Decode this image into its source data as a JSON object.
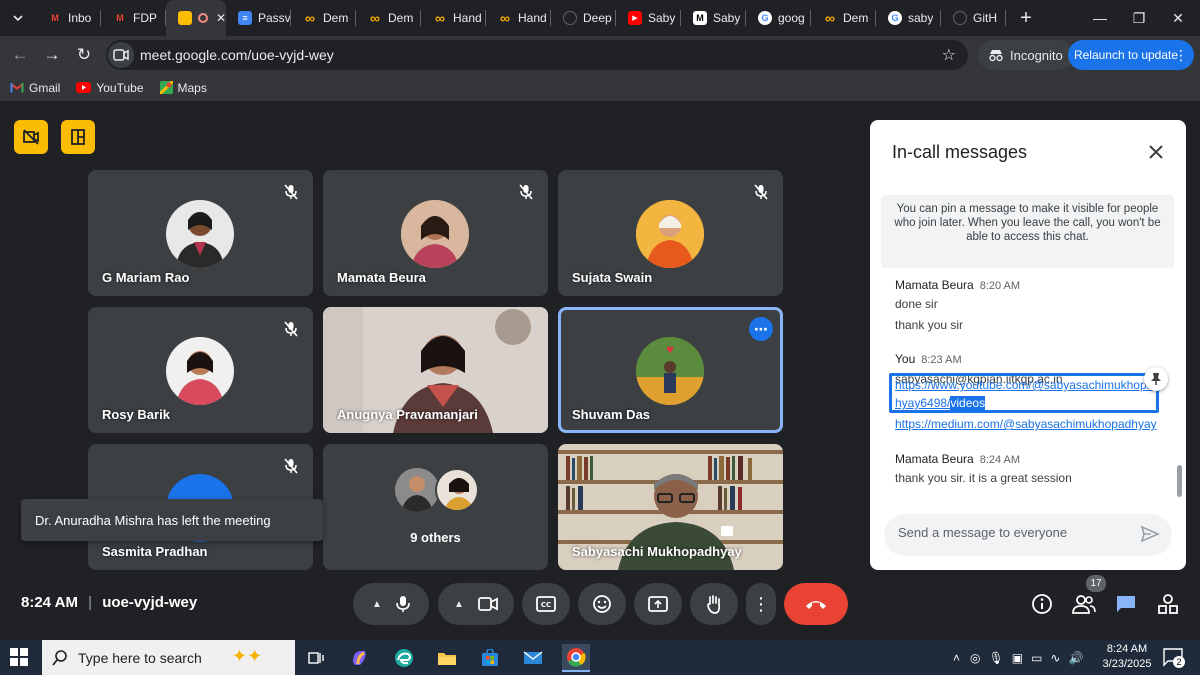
{
  "browser": {
    "tabs": [
      {
        "label": "Inbo",
        "favicon": "gmail-icon",
        "color": "#ea4335"
      },
      {
        "label": "FDP",
        "favicon": "gmail-icon",
        "color": "#ea4335"
      },
      {
        "label": "",
        "favicon": "meet-icon",
        "color": "#34a853",
        "active": true
      },
      {
        "label": "Passv",
        "favicon": "docs-icon",
        "color": "#4285f4"
      },
      {
        "label": "Dem",
        "favicon": "colab-icon",
        "color": "#f9ab00"
      },
      {
        "label": "Dem",
        "favicon": "colab-icon",
        "color": "#f9ab00"
      },
      {
        "label": "Hand",
        "favicon": "colab-icon",
        "color": "#f9ab00"
      },
      {
        "label": "Hand",
        "favicon": "colab-icon",
        "color": "#f9ab00"
      },
      {
        "label": "Deep",
        "favicon": "loading-icon",
        "color": "#5f6368"
      },
      {
        "label": "Saby",
        "favicon": "youtube-icon",
        "color": "#ff0000"
      },
      {
        "label": "Saby",
        "favicon": "medium-icon",
        "color": "#000000"
      },
      {
        "label": "goog",
        "favicon": "google-icon",
        "color": "#ffffff"
      },
      {
        "label": "Dem",
        "favicon": "colab-icon",
        "color": "#f9ab00"
      },
      {
        "label": "saby",
        "favicon": "google-icon",
        "color": "#ffffff"
      },
      {
        "label": "GitH",
        "favicon": "github-icon",
        "color": "#5f6368"
      }
    ],
    "url": "meet.google.com/uoe-vyjd-wey",
    "incognito_label": "Incognito",
    "relaunch_label": "Relaunch to update",
    "bookmarks": [
      {
        "label": "Gmail",
        "icon": "gmail-icon"
      },
      {
        "label": "YouTube",
        "icon": "youtube-icon"
      },
      {
        "label": "Maps",
        "icon": "maps-icon"
      }
    ]
  },
  "meet": {
    "participants": [
      {
        "name": "G Mariam Rao"
      },
      {
        "name": "Mamata Beura"
      },
      {
        "name": "Sujata Swain"
      },
      {
        "name": "Rosy Barik"
      },
      {
        "name": "Anugnya Pravamanjari"
      },
      {
        "name": "Shuvam Das"
      },
      {
        "name": "Sasmita Pradhan"
      },
      {
        "name": "9 others"
      },
      {
        "name": "Sabyasachi Mukhopadhyay"
      }
    ],
    "toast": "Dr. Anuradha Mishra has left the meeting",
    "time": "8:24 AM",
    "meeting_code": "uoe-vyjd-wey",
    "people_count": "17",
    "colors": {
      "accent": "#8ab4f8",
      "end_call": "#ea4335",
      "warning": "#fbbc04"
    }
  },
  "chat": {
    "title": "In-call messages",
    "info": "You can pin a message to make it visible for people who join later. When you leave the call, you won't be able to access this chat.",
    "messages": [
      {
        "sender": "Mamata Beura",
        "time": "8:20 AM",
        "lines": [
          "done sir",
          "thank you sir"
        ]
      },
      {
        "sender": "You",
        "time": "8:23 AM",
        "lines": [
          "sabyasachi@kgpian.iitkgp.ac.in"
        ],
        "links": [
          "https://www.youtube.com/@sabyasachimukhopadhyay6498/videos",
          "https://medium.com/@sabyasachimukhopadhyay"
        ],
        "link1_line1": "https://www.youtube.com/@sabyasachimukhopad",
        "link1_line2": "hyay6498/",
        "link1_selected": "videos"
      },
      {
        "sender": "Mamata Beura",
        "time": "8:24 AM",
        "lines": [
          "thank you sir. it is a great session"
        ]
      }
    ],
    "input_placeholder": "Send a message to everyone"
  },
  "taskbar": {
    "search_placeholder": "Type here to search",
    "time": "8:24 AM",
    "date": "3/23/2025",
    "notification_count": "2"
  }
}
